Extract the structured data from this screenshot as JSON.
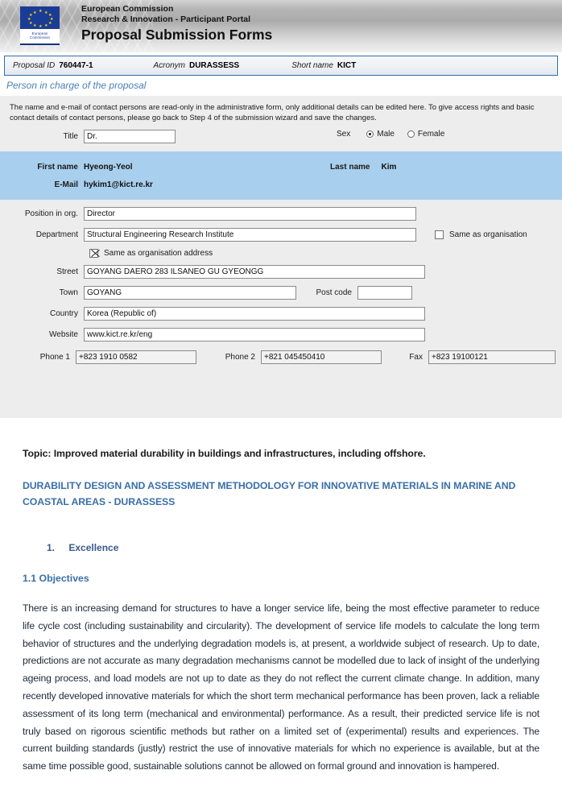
{
  "header": {
    "logo_caption_line1": "European",
    "logo_caption_line2": "Commission",
    "line1": "European Commission",
    "line2": "Research & Innovation - Participant Portal",
    "main_title": "Proposal Submission Forms"
  },
  "proposal_bar": {
    "proposal_id_label": "Proposal ID",
    "proposal_id_value": "760447-1",
    "acronym_label": "Acronym",
    "acronym_value": "DURASSESS",
    "short_name_label": "Short name",
    "short_name_value": "KICT"
  },
  "section": {
    "title": "Person in charge of the proposal",
    "notice": "The name and e-mail of contact persons are read-only in the administrative form, only additional details can be edited here. To give access rights and basic contact details of contact persons, please go back to Step 4 of the submission wizard and save the changes."
  },
  "form": {
    "title_label": "Title",
    "title_value": "Dr.",
    "sex_label": "Sex",
    "sex_male_label": "Male",
    "sex_female_label": "Female",
    "sex_selected": "Male",
    "first_name_label": "First name",
    "first_name_value": "Hyeong-Yeol",
    "last_name_label": "Last  name",
    "last_name_value": "Kim",
    "email_label": "E-Mail",
    "email_value": "hykim1@kict.re.kr",
    "position_label": "Position in org.",
    "position_value": "Director",
    "department_label": "Department",
    "department_value": "Structural Engineering Research Institute",
    "same_as_organisation_label": "Same as organisation",
    "same_as_organisation_checked": false,
    "same_as_org_address_label": "Same as organisation address",
    "same_as_org_address_checked": true,
    "street_label": "Street",
    "street_value": "GOYANG DAERO 283 ILSANEO GU GYEONGG",
    "town_label": "Town",
    "town_value": "GOYANG",
    "post_code_label": "Post code",
    "post_code_value": "",
    "country_label": "Country",
    "country_value": "Korea (Republic of)",
    "website_label": "Website",
    "website_value": "www.kict.re.kr/eng",
    "phone1_label": "Phone 1",
    "phone1_value": "+823 1910 0582",
    "phone2_label": "Phone 2",
    "phone2_value": "+821 045450410",
    "fax_label": "Fax",
    "fax_value": "+823 19100121"
  },
  "document": {
    "topic": "Topic: Improved material durability in buildings and infrastructures, including offshore.",
    "project_title": "DURABILITY DESIGN AND ASSESSMENT METHODOLOGY FOR INNOVATIVE MATERIALS IN MARINE AND COASTAL AREAS - DURASSESS",
    "heading1_number": "1.",
    "heading1_text": "Excellence",
    "heading2": "1.1 Objectives",
    "paragraph": "There is an increasing demand for structures to have a longer service life, being the most effective parameter to reduce life cycle cost (including sustainability and circularity). The development of service life models to calculate the long term behavior of structures and the underlying degradation models is, at present, a worldwide subject of research. Up to date, predictions are not accurate as many degradation mechanisms cannot be modelled due to lack of insight of the underlying ageing process, and load models are not up to date as they do not reflect the current climate change. In addition, many recently developed innovative materials for which the short term mechanical performance has been proven, lack a reliable assessment of its long term (mechanical and environmental) performance. As a result, their predicted service life is not truly based on rigorous scientific methods but rather on a limited set of (experimental) results and experiences. The current building standards (justly) restrict the use of innovative materials for which no experience is available, but at the same time possible good, sustainable solutions cannot be allowed on formal ground and innovation is hampered."
  },
  "colors": {
    "accent_blue": "#3a6fa8",
    "highlight_row": "#a9cfee",
    "form_bg": "#ededed",
    "bar_border": "#2f6fad"
  }
}
